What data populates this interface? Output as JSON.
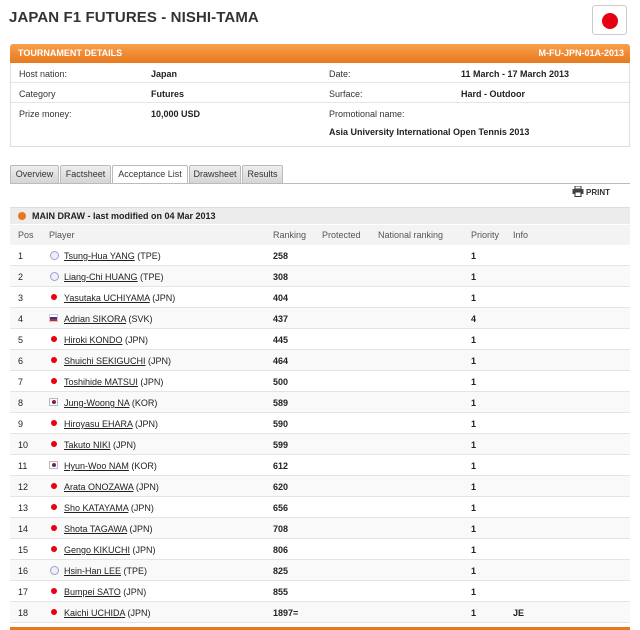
{
  "page": {
    "title": "JAPAN F1 FUTURES - NISHI-TAMA"
  },
  "details": {
    "header_label": "TOURNAMENT DETAILS",
    "code": "M-FU-JPN-01A-2013",
    "host_nation_label": "Host nation:",
    "host_nation": "Japan",
    "date_label": "Date:",
    "date": "11 March - 17 March 2013",
    "category_label": "Category",
    "category": "Futures",
    "surface_label": "Surface:",
    "surface": "Hard - Outdoor",
    "prize_label": "Prize money:",
    "prize": "10,000 USD",
    "promo_label": "Promotional name:",
    "promo": "Asia University International Open Tennis 2013"
  },
  "tabs": [
    {
      "label": "Overview"
    },
    {
      "label": "Factsheet"
    },
    {
      "label": "Acceptance List"
    },
    {
      "label": "Drawsheet"
    },
    {
      "label": "Results"
    }
  ],
  "print_label": "PRINT",
  "main_draw": {
    "title": "MAIN DRAW - last modified on 04 Mar 2013",
    "columns": {
      "pos": "Pos",
      "player": "Player",
      "ranking": "Ranking",
      "protected": "Protected",
      "national": "National ranking",
      "priority": "Priority",
      "info": "Info"
    },
    "rows": [
      {
        "pos": "1",
        "flag": "tpe",
        "name": "Tsung-Hua YANG",
        "nat": "(TPE)",
        "ranking": "258",
        "priority": "1",
        "info": ""
      },
      {
        "pos": "2",
        "flag": "tpe",
        "name": "Liang-Chi HUANG",
        "nat": "(TPE)",
        "ranking": "308",
        "priority": "1",
        "info": ""
      },
      {
        "pos": "3",
        "flag": "jp",
        "name": "Yasutaka UCHIYAMA",
        "nat": "(JPN)",
        "ranking": "404",
        "priority": "1",
        "info": ""
      },
      {
        "pos": "4",
        "flag": "svk",
        "name": "Adrian SIKORA",
        "nat": "(SVK)",
        "ranking": "437",
        "priority": "4",
        "info": ""
      },
      {
        "pos": "5",
        "flag": "jp",
        "name": "Hiroki KONDO",
        "nat": "(JPN)",
        "ranking": "445",
        "priority": "1",
        "info": ""
      },
      {
        "pos": "6",
        "flag": "jp",
        "name": "Shuichi SEKIGUCHI",
        "nat": "(JPN)",
        "ranking": "464",
        "priority": "1",
        "info": ""
      },
      {
        "pos": "7",
        "flag": "jp",
        "name": "Toshihide MATSUI",
        "nat": "(JPN)",
        "ranking": "500",
        "priority": "1",
        "info": ""
      },
      {
        "pos": "8",
        "flag": "kor",
        "name": "Jung-Woong NA",
        "nat": "(KOR)",
        "ranking": "589",
        "priority": "1",
        "info": ""
      },
      {
        "pos": "9",
        "flag": "jp",
        "name": "Hiroyasu EHARA",
        "nat": "(JPN)",
        "ranking": "590",
        "priority": "1",
        "info": ""
      },
      {
        "pos": "10",
        "flag": "jp",
        "name": "Takuto NIKI",
        "nat": "(JPN)",
        "ranking": "599",
        "priority": "1",
        "info": ""
      },
      {
        "pos": "11",
        "flag": "kor",
        "name": "Hyun-Woo NAM",
        "nat": "(KOR)",
        "ranking": "612",
        "priority": "1",
        "info": ""
      },
      {
        "pos": "12",
        "flag": "jp",
        "name": "Arata ONOZAWA",
        "nat": "(JPN)",
        "ranking": "620",
        "priority": "1",
        "info": ""
      },
      {
        "pos": "13",
        "flag": "jp",
        "name": "Sho KATAYAMA",
        "nat": "(JPN)",
        "ranking": "656",
        "priority": "1",
        "info": ""
      },
      {
        "pos": "14",
        "flag": "jp",
        "name": "Shota TAGAWA",
        "nat": "(JPN)",
        "ranking": "708",
        "priority": "1",
        "info": ""
      },
      {
        "pos": "15",
        "flag": "jp",
        "name": "Gengo KIKUCHI",
        "nat": "(JPN)",
        "ranking": "806",
        "priority": "1",
        "info": ""
      },
      {
        "pos": "16",
        "flag": "tpe",
        "name": "Hsin-Han LEE",
        "nat": "(TPE)",
        "ranking": "825",
        "priority": "1",
        "info": ""
      },
      {
        "pos": "17",
        "flag": "jp",
        "name": "Bumpei SATO",
        "nat": "(JPN)",
        "ranking": "855",
        "priority": "1",
        "info": ""
      },
      {
        "pos": "18",
        "flag": "jp",
        "name": "Kaichi UCHIDA",
        "nat": "(JPN)",
        "ranking": "1897=",
        "priority": "1",
        "info": "JE"
      }
    ]
  },
  "colors": {
    "accent": "#e9781c",
    "flag_red": "#e60012"
  }
}
